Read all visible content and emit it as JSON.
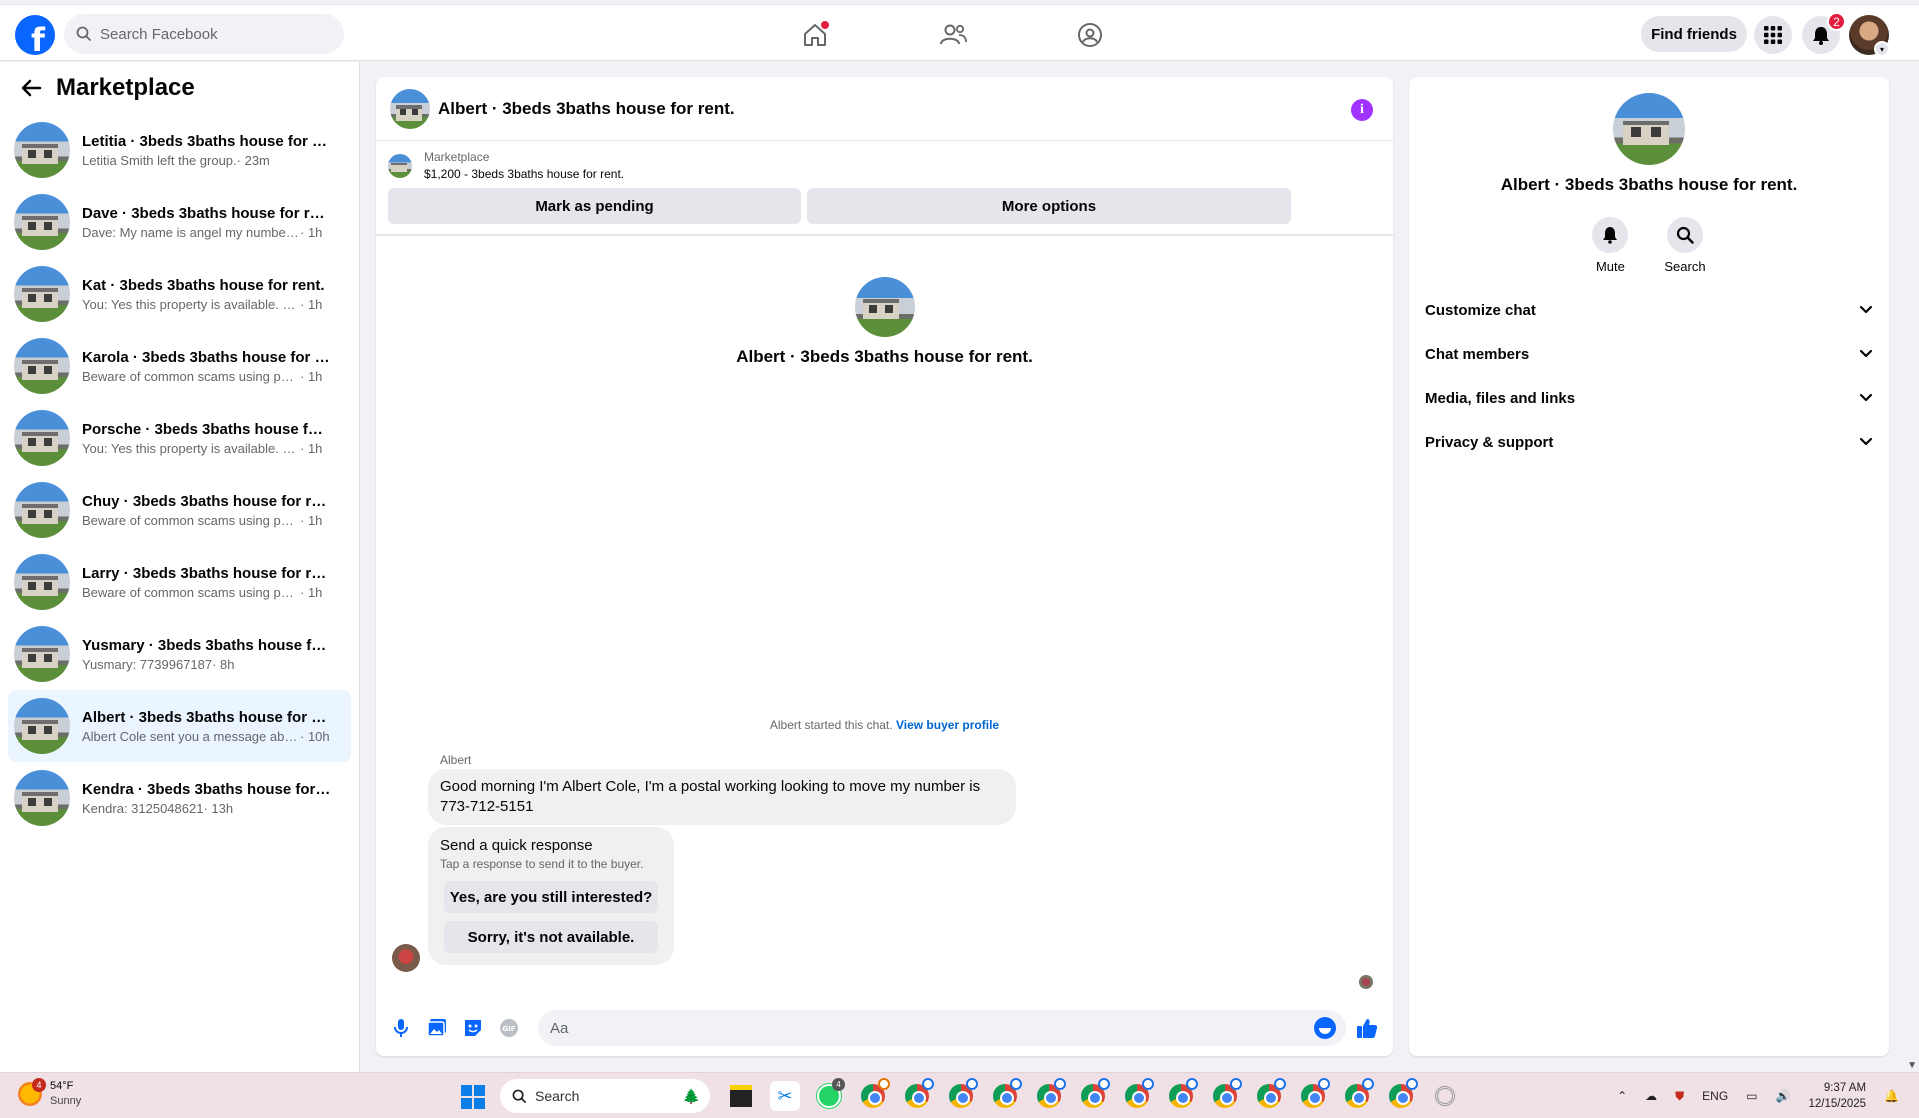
{
  "topbar": {
    "logo": "f",
    "search_placeholder": "Search Facebook",
    "find_friends": "Find friends",
    "notifications_count": "2",
    "icons": [
      "facebook-logo",
      "search-icon",
      "home-icon",
      "friends-icon",
      "groups-icon",
      "menu-grid-icon",
      "bell-icon",
      "avatar"
    ]
  },
  "sidebar": {
    "title": "Marketplace",
    "conversations": [
      {
        "name": "Letitia · 3beds 3baths house for re...",
        "snippet": "Letitia Smith left the group.",
        "time": " · 23m",
        "active": false
      },
      {
        "name": "Dave · 3beds 3baths house for rent.",
        "snippet": "Dave: My name is angel my number3...",
        "time": " · 1h",
        "active": false
      },
      {
        "name": "Kat · 3beds 3baths house for rent.",
        "snippet": "You: Yes this property is available. For ...",
        "time": " · 1h",
        "active": false
      },
      {
        "name": "Karola · 3beds 3baths house for re...",
        "snippet": "Beware of common scams using pay...",
        "time": " · 1h",
        "active": false
      },
      {
        "name": "Porsche · 3beds 3baths house for r...",
        "snippet": "You: Yes this property is available. For ...",
        "time": " · 1h",
        "active": false
      },
      {
        "name": "Chuy · 3beds 3baths house for rent.",
        "snippet": "Beware of common scams using pay...",
        "time": " · 1h",
        "active": false
      },
      {
        "name": "Larry · 3beds 3baths house for rent.",
        "snippet": "Beware of common scams using pay...",
        "time": " · 1h",
        "active": false
      },
      {
        "name": "Yusmary · 3beds 3baths house for ...",
        "snippet": "Yusmary: 7739967187",
        "time": " · 8h",
        "active": false
      },
      {
        "name": "Albert · 3beds 3baths house for re...",
        "snippet": "Albert Cole sent you a message abo...",
        "time": " · 10h",
        "active": true
      },
      {
        "name": "Kendra · 3beds 3baths house for r...",
        "snippet": "Kendra: 3125048621",
        "time": " · 13h",
        "active": false
      }
    ]
  },
  "chat": {
    "title": "Albert · 3beds 3baths house for rent.",
    "marketplace_label": "Marketplace",
    "listing": "$1,200 - 3beds 3baths house for rent.",
    "mark_pending": "Mark as pending",
    "more_options": "More options",
    "intro_title": "Albert · 3beds 3baths house for rent.",
    "started_text": "Albert started this chat.",
    "view_profile": "View buyer profile",
    "sender": "Albert",
    "message": "Good morning I'm Albert Cole,  I'm a postal working looking to move my number is 773-712-5151",
    "quick_title": "Send a quick response",
    "quick_sub": "Tap a response to send it to the buyer.",
    "quick_1": "Yes, are you still interested?",
    "quick_2": "Sorry, it's not available.",
    "input_placeholder": "Aa"
  },
  "details": {
    "title": "Albert · 3beds 3baths house for rent.",
    "mute": "Mute",
    "search": "Search",
    "sections": [
      "Customize chat",
      "Chat members",
      "Media, files and links",
      "Privacy & support"
    ]
  },
  "taskbar": {
    "weather_badge": "4",
    "temp": "54°F",
    "condition": "Sunny",
    "search": "Search",
    "whatsapp_badge": "4",
    "lang": "ENG",
    "time": "9:37 AM",
    "date": "12/15/2025"
  },
  "colors": {
    "brand_blue": "#0866ff",
    "badge_red": "#e41e3f",
    "info_purple": "#a033ff",
    "active_row": "#ebf5ff"
  }
}
